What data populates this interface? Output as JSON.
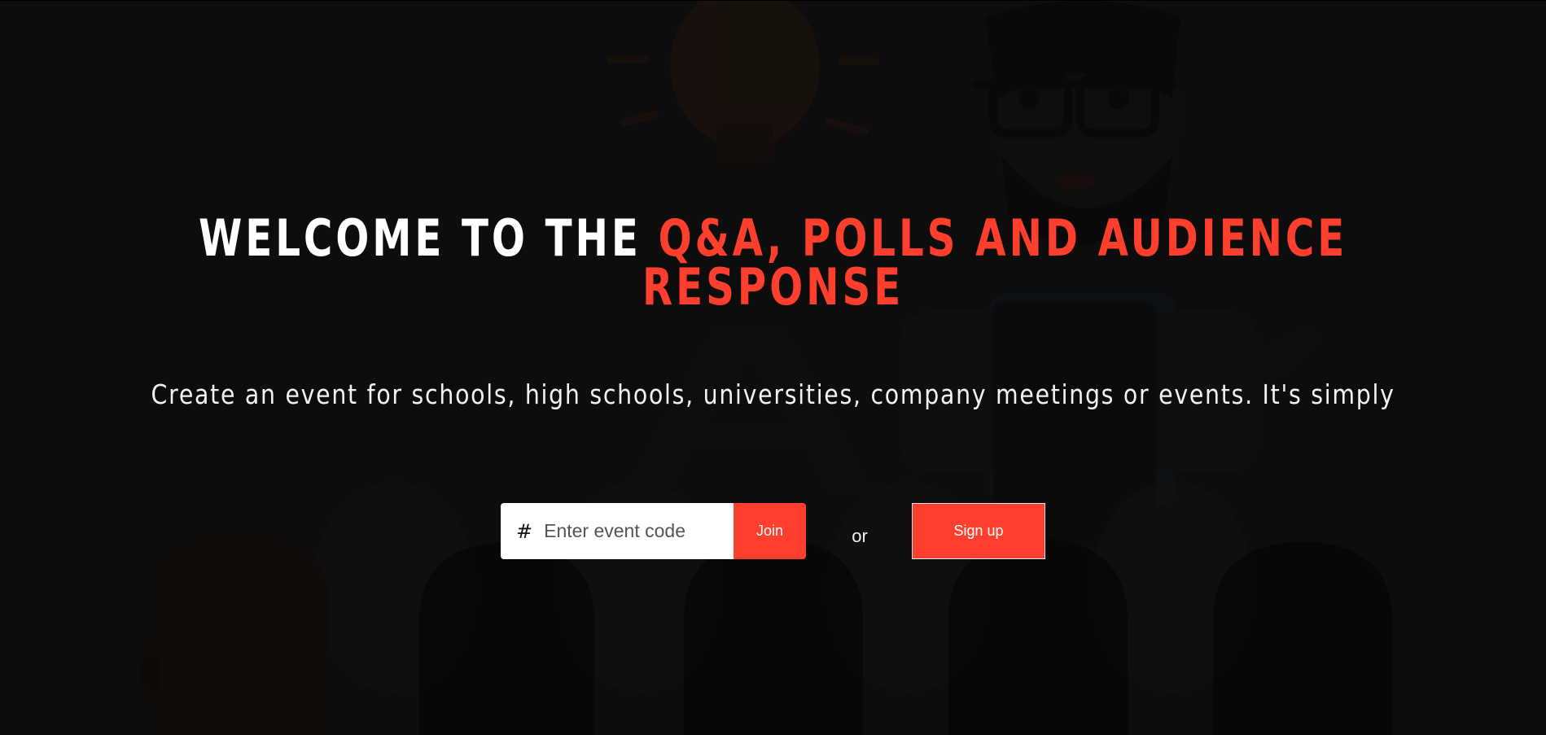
{
  "hero": {
    "title_main": "WELCOME TO THE ",
    "title_accent": "Q&A, POLLS AND AUDIENCE RESPONSE",
    "subtitle": "Create an event for schools, high schools, universities, company meetings or events. It's simply"
  },
  "join": {
    "hash_symbol": "#",
    "placeholder": "Enter event code",
    "value": "",
    "join_label": "Join"
  },
  "separator": "or",
  "signup": {
    "label": "Sign up"
  },
  "colors": {
    "accent": "#ff3f2e",
    "background": "#121212",
    "text": "#ffffff"
  },
  "icons": {
    "background_art": "presenter-with-audience-illustration"
  }
}
